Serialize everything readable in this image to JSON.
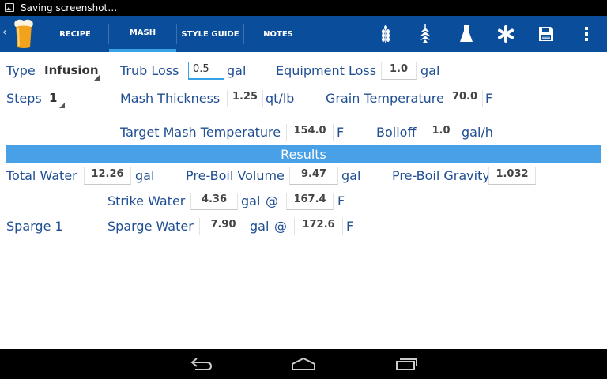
{
  "status_bar": {
    "notification_text": "Saving screenshot…"
  },
  "tabs": [
    {
      "label": "RECIPE",
      "selected": false
    },
    {
      "label": "MASH",
      "selected": true
    },
    {
      "label": "STYLE GUIDE",
      "selected": false
    },
    {
      "label": "NOTES",
      "selected": false
    }
  ],
  "action_icons": [
    "grain-icon",
    "hops-icon",
    "flask-icon",
    "asterisk-icon",
    "save-icon",
    "overflow-menu-icon"
  ],
  "colors": {
    "action_bar": "#0a4d9b",
    "tab_indicator": "#39a3e5",
    "results_bar": "#48a0e7",
    "label_text": "#1f4e93"
  },
  "form": {
    "type_label": "Type",
    "type_value": "Infusion",
    "trub_loss_label": "Trub Loss",
    "trub_loss_value": "0.5",
    "trub_loss_unit": "gal",
    "equipment_loss_label": "Equipment Loss",
    "equipment_loss_value": "1.0",
    "equipment_loss_unit": "gal",
    "steps_label": "Steps",
    "steps_value": "1",
    "mash_thickness_label": "Mash Thickness",
    "mash_thickness_value": "1.25",
    "mash_thickness_unit": "qt/lb",
    "grain_temp_label": "Grain Temperature",
    "grain_temp_value": "70.0",
    "grain_temp_unit": "F",
    "target_mash_temp_label": "Target Mash Temperature",
    "target_mash_temp_value": "154.0",
    "target_mash_temp_unit": "F",
    "boiloff_label": "Boiloff",
    "boiloff_value": "1.0",
    "boiloff_unit": "gal/h"
  },
  "results": {
    "header": "Results",
    "total_water_label": "Total Water",
    "total_water_value": "12.26",
    "total_water_unit": "gal",
    "preboil_volume_label": "Pre-Boil Volume",
    "preboil_volume_value": "9.47",
    "preboil_volume_unit": "gal",
    "preboil_gravity_label": "Pre-Boil Gravity",
    "preboil_gravity_value": "1.032",
    "strike_water_label": "Strike Water",
    "strike_water_value": "4.36",
    "strike_water_unit": "gal",
    "strike_at": "@",
    "strike_temp_value": "167.4",
    "strike_temp_unit": "F",
    "sparge_label": "Sparge 1",
    "sparge_water_label": "Sparge Water",
    "sparge_water_value": "7.90",
    "sparge_water_unit": "gal",
    "sparge_at": "@",
    "sparge_temp_value": "172.6",
    "sparge_temp_unit": "F"
  }
}
